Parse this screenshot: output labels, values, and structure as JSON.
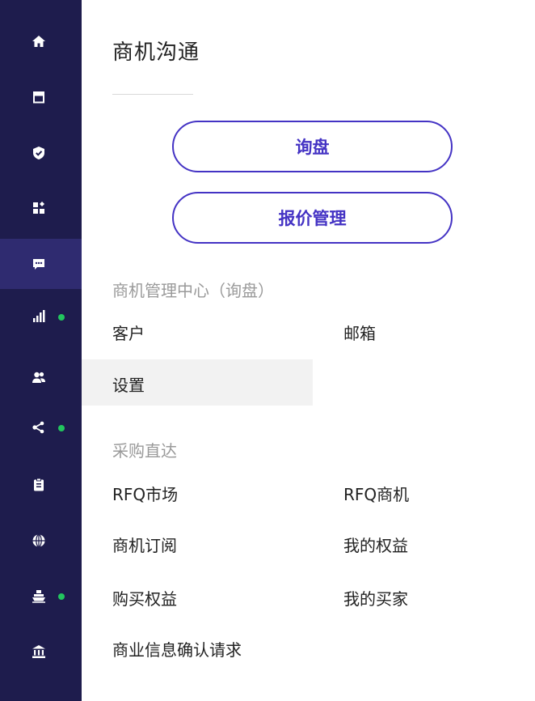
{
  "nav": {
    "items": [
      {
        "id": "home",
        "icon": "home-icon",
        "badge": false
      },
      {
        "id": "store",
        "icon": "store-icon",
        "badge": false
      },
      {
        "id": "security",
        "icon": "shield-icon",
        "badge": false
      },
      {
        "id": "apps",
        "icon": "grid-icon",
        "badge": false
      },
      {
        "id": "messages",
        "icon": "chat-icon",
        "badge": false,
        "active": true
      },
      {
        "id": "analytics",
        "icon": "bar-chart-icon",
        "badge": true
      },
      {
        "id": "customers",
        "icon": "users-icon",
        "badge": false
      },
      {
        "id": "network",
        "icon": "share-icon",
        "badge": true
      },
      {
        "id": "orders",
        "icon": "clipboard-icon",
        "badge": false
      },
      {
        "id": "global",
        "icon": "globe-icon",
        "badge": false
      },
      {
        "id": "shipping",
        "icon": "ship-icon",
        "badge": true
      },
      {
        "id": "finance",
        "icon": "bank-icon",
        "badge": false
      }
    ],
    "colors": {
      "background": "#1e1c4d",
      "active": "#2f2b70",
      "badge": "#22c55e"
    }
  },
  "panel": {
    "title": "商机沟通",
    "buttons": {
      "inquiry": "询盘",
      "quote_manage": "报价管理"
    },
    "accent": "#4433c4",
    "sections": {
      "opportunity": {
        "heading": "商机管理中心（询盘）",
        "items": {
          "customers": "客户",
          "mailbox": "邮箱",
          "settings": "设置"
        }
      },
      "procurement": {
        "heading": "采购直达",
        "items": {
          "rfq_market": "RFQ市场",
          "rfq_opportunity": "RFQ商机",
          "subscription": "商机订阅",
          "my_rights": "我的权益",
          "buy_rights": "购买权益",
          "my_buyers": "我的买家",
          "confirm_request": "商业信息确认请求"
        }
      }
    }
  }
}
